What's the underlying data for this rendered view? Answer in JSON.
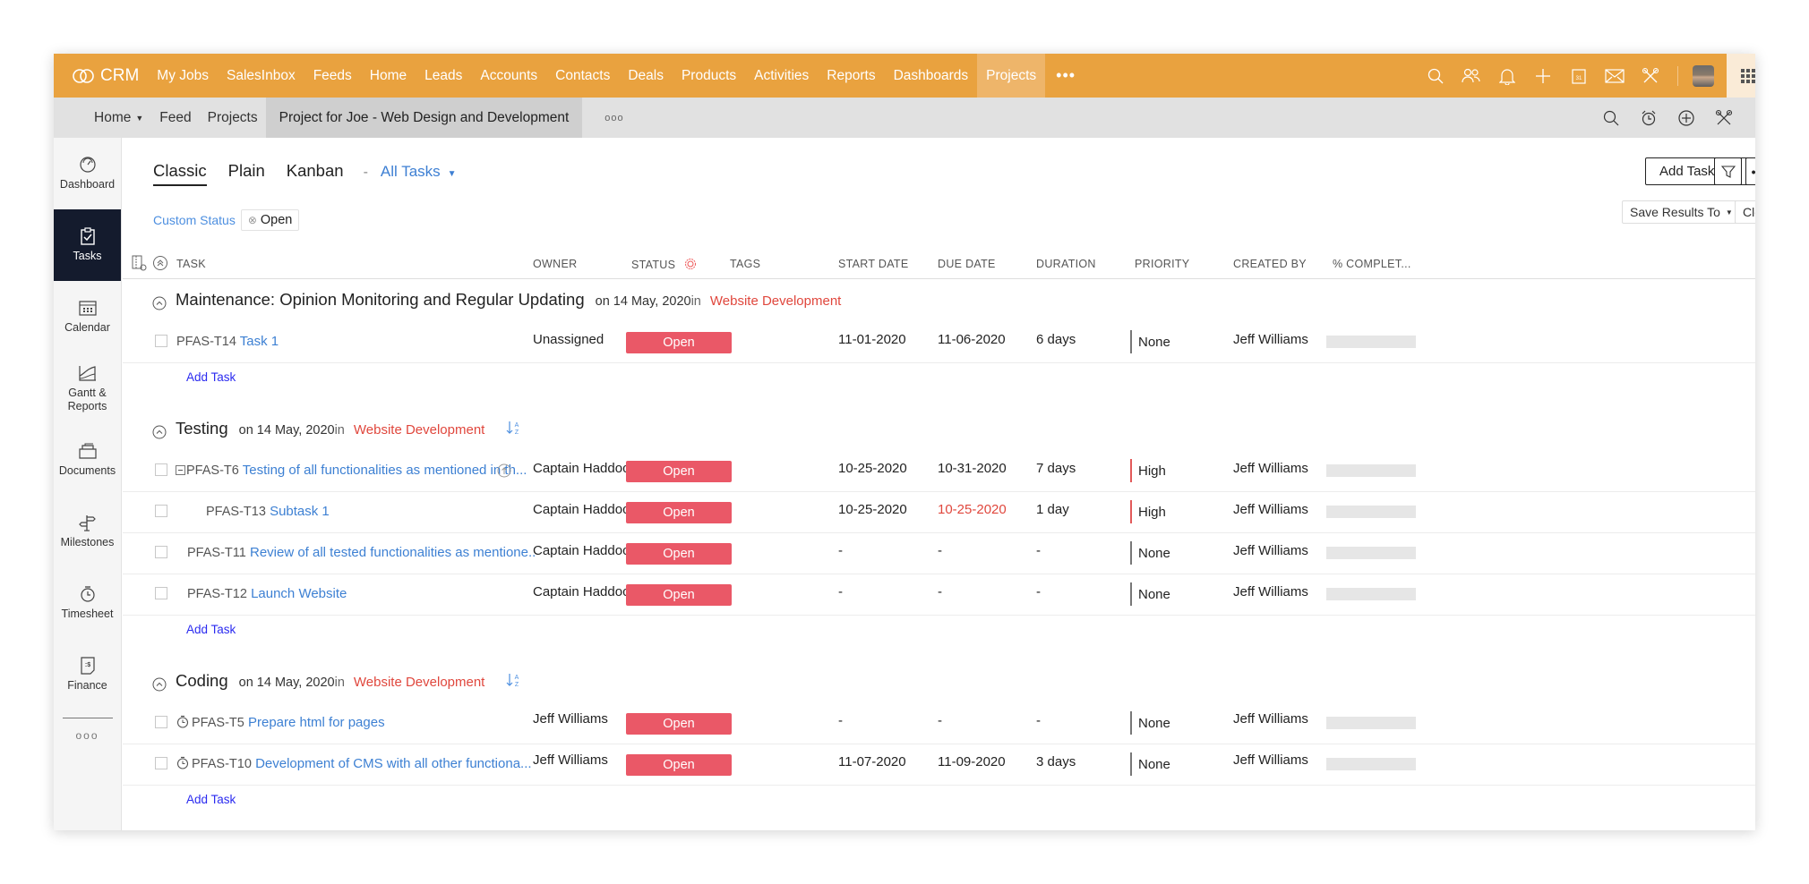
{
  "app": {
    "brand": "CRM",
    "top_nav": [
      "My Jobs",
      "SalesInbox",
      "Feeds",
      "Home",
      "Leads",
      "Accounts",
      "Contacts",
      "Deals",
      "Products",
      "Activities",
      "Reports",
      "Dashboards",
      "Projects"
    ],
    "top_nav_active": "Projects",
    "top_nav_more": "•••",
    "top_icons": [
      "search-icon",
      "users-icon",
      "bell-icon",
      "plus-icon",
      "calendar-icon",
      "mail-icon",
      "tools-icon",
      "avatar",
      "apps-grid-icon"
    ]
  },
  "subnav": {
    "items": [
      "Home",
      "Feed",
      "Projects",
      "Project for Joe - Web Design and Development"
    ],
    "active": "Project for Joe - Web Design and Development",
    "more": "ooo",
    "icons": [
      "search-icon",
      "alarm-icon",
      "add-circle-icon",
      "tools-icon"
    ]
  },
  "sidebar": {
    "items": [
      {
        "label": "Dashboard",
        "icon": "speedometer-icon"
      },
      {
        "label": "Tasks",
        "icon": "clipboard-check-icon",
        "active": true
      },
      {
        "label": "Calendar",
        "icon": "calendar-icon"
      },
      {
        "label": "Gantt & Reports",
        "icon": "chart-area-icon"
      },
      {
        "label": "Documents",
        "icon": "folder-icon"
      },
      {
        "label": "Milestones",
        "icon": "signpost-icon"
      },
      {
        "label": "Timesheet",
        "icon": "stopwatch-icon"
      },
      {
        "label": "Finance",
        "icon": "invoice-icon"
      }
    ],
    "more": "ooo"
  },
  "toolbar": {
    "views": [
      "Classic",
      "Plain",
      "Kanban"
    ],
    "active_view": "Classic",
    "separator": "-",
    "filter_view": "All Tasks",
    "add_task": "Add Task",
    "save_results": "Save Results To",
    "clear_filter": "Clear filter",
    "filter_label": "Custom Status",
    "filter_chip": "Open"
  },
  "columns": [
    "TASK",
    "OWNER",
    "STATUS",
    "TAGS",
    "START DATE",
    "DUE DATE",
    "DURATION",
    "PRIORITY",
    "CREATED BY",
    "% COMPLET..."
  ],
  "colors": {
    "accent": "#e9a23f",
    "status_open": "#ea5867",
    "link": "#3d80d3",
    "project_link": "#e0473d",
    "sidebar_active": "#141b2d"
  },
  "groups": [
    {
      "name": "Maintenance: Opinion Monitoring and Regular Updating",
      "date_text": "on 14 May, 2020",
      "in_text": "in",
      "project": "Website Development",
      "add_task": "Add Task",
      "tasks": [
        {
          "id": "PFAS-T14",
          "name": "Task 1",
          "owner": "Unassigned",
          "status": "Open",
          "start": "11-01-2020",
          "due": "11-06-2020",
          "duration": "6 days",
          "priority": "None",
          "created_by": "Jeff Williams",
          "complete_pct": 0
        }
      ]
    },
    {
      "name": "Testing",
      "date_text": "on 14 May, 2020",
      "in_text": "in",
      "project": "Website Development",
      "add_task": "Add Task",
      "tasks": [
        {
          "id": "PFAS-T6",
          "name": "Testing of all functionalities as mentioned in th...",
          "owner": "Captain Haddoc",
          "status": "Open",
          "start": "10-25-2020",
          "due": "10-31-2020",
          "duration": "7 days",
          "priority": "High",
          "created_by": "Jeff Williams",
          "complete_pct": 0,
          "has_subtasks": true,
          "has_dependency": true
        },
        {
          "id": "PFAS-T13",
          "name": "Subtask 1",
          "owner": "Captain Haddoc",
          "status": "Open",
          "start": "10-25-2020",
          "due": "10-25-2020",
          "due_overdue": true,
          "duration": "1 day",
          "priority": "High",
          "created_by": "Jeff Williams",
          "complete_pct": 0,
          "is_subtask": true
        },
        {
          "id": "PFAS-T11",
          "name": "Review of all tested functionalities as mentione..",
          "owner": "Captain Haddoc",
          "status": "Open",
          "start": "-",
          "due": "-",
          "duration": "-",
          "priority": "None",
          "created_by": "Jeff Williams",
          "complete_pct": 0
        },
        {
          "id": "PFAS-T12",
          "name": "Launch Website",
          "owner": "Captain Haddoc",
          "status": "Open",
          "start": "-",
          "due": "-",
          "duration": "-",
          "priority": "None",
          "created_by": "Jeff Williams",
          "complete_pct": 0
        }
      ]
    },
    {
      "name": "Coding",
      "date_text": "on 14 May, 2020",
      "in_text": "in",
      "project": "Website Development",
      "add_task": "Add Task",
      "tasks": [
        {
          "id": "PFAS-T5",
          "name": "Prepare html for pages",
          "owner": "Jeff Williams",
          "status": "Open",
          "start": "-",
          "due": "-",
          "duration": "-",
          "priority": "None",
          "created_by": "Jeff Williams",
          "complete_pct": 0,
          "has_timer": true
        },
        {
          "id": "PFAS-T10",
          "name": "Development of CMS with all other functiona...",
          "owner": "Jeff Williams",
          "status": "Open",
          "start": "11-07-2020",
          "due": "11-09-2020",
          "duration": "3 days",
          "priority": "None",
          "created_by": "Jeff Williams",
          "complete_pct": 0,
          "has_timer": true
        }
      ]
    }
  ]
}
